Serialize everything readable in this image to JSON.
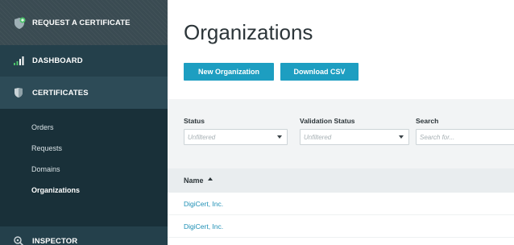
{
  "sidebar": {
    "request_label": "REQUEST A CERTIFICATE",
    "dashboard_label": "DASHBOARD",
    "certificates_label": "CERTIFICATES",
    "sub_items": [
      {
        "label": "Orders"
      },
      {
        "label": "Requests"
      },
      {
        "label": "Domains"
      },
      {
        "label": "Organizations"
      }
    ],
    "inspector_label": "INSPECTOR",
    "active_item": "Organizations"
  },
  "main": {
    "title": "Organizations",
    "buttons": {
      "new_label": "New Organization",
      "csv_label": "Download CSV"
    },
    "filters": {
      "status_label": "Status",
      "status_value": "Unfiltered",
      "validation_label": "Validation Status",
      "validation_value": "Unfiltered",
      "search_label": "Search",
      "search_placeholder": "Search for..."
    },
    "table": {
      "column_name": "Name",
      "rows": [
        {
          "name": "DigiCert, Inc."
        },
        {
          "name": "DigiCert, Inc."
        }
      ]
    }
  },
  "colors": {
    "accent": "#1d9ec1",
    "link": "#1d8fb5",
    "sidebar_bg": "#1f3640"
  }
}
